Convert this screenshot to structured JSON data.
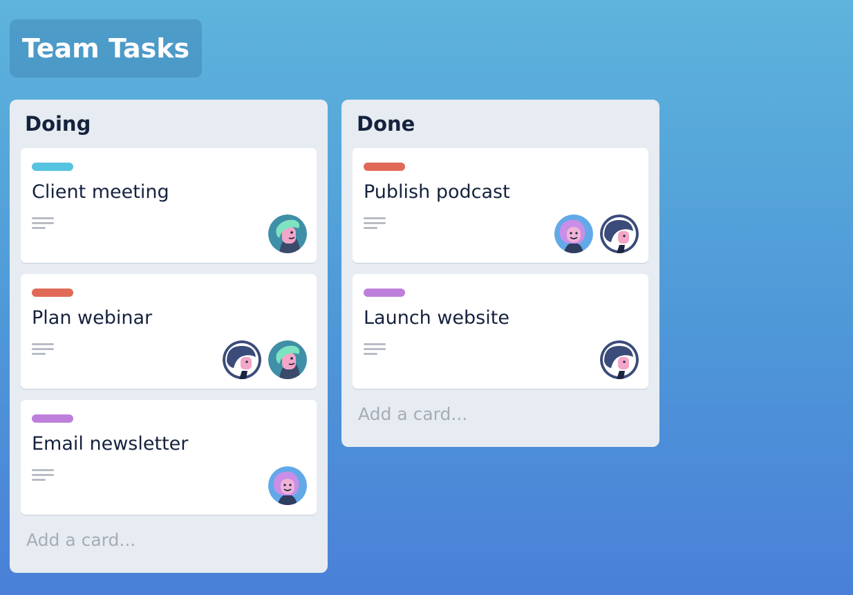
{
  "board": {
    "title": "Team Tasks"
  },
  "colors": {
    "teal": "#56c3e0",
    "red": "#e06a57",
    "purple": "#be7fdc"
  },
  "lists": [
    {
      "title": "Doing",
      "add_card": "Add a card...",
      "cards": [
        {
          "title": "Client meeting",
          "label_color": "teal",
          "avatars": [
            "green-haired-avatar-icon"
          ]
        },
        {
          "title": "Plan webinar",
          "label_color": "red",
          "avatars": [
            "white-haired-avatar-icon",
            "green-haired-avatar-icon"
          ]
        },
        {
          "title": "Email newsletter",
          "label_color": "purple",
          "avatars": [
            "purple-haired-avatar-icon"
          ]
        }
      ]
    },
    {
      "title": "Done",
      "add_card": "Add a card...",
      "cards": [
        {
          "title": "Publish podcast",
          "label_color": "red",
          "avatars": [
            "purple-haired-avatar-icon",
            "white-haired-avatar-icon"
          ]
        },
        {
          "title": "Launch website",
          "label_color": "purple",
          "avatars": [
            "white-haired-avatar-icon"
          ]
        }
      ]
    }
  ]
}
